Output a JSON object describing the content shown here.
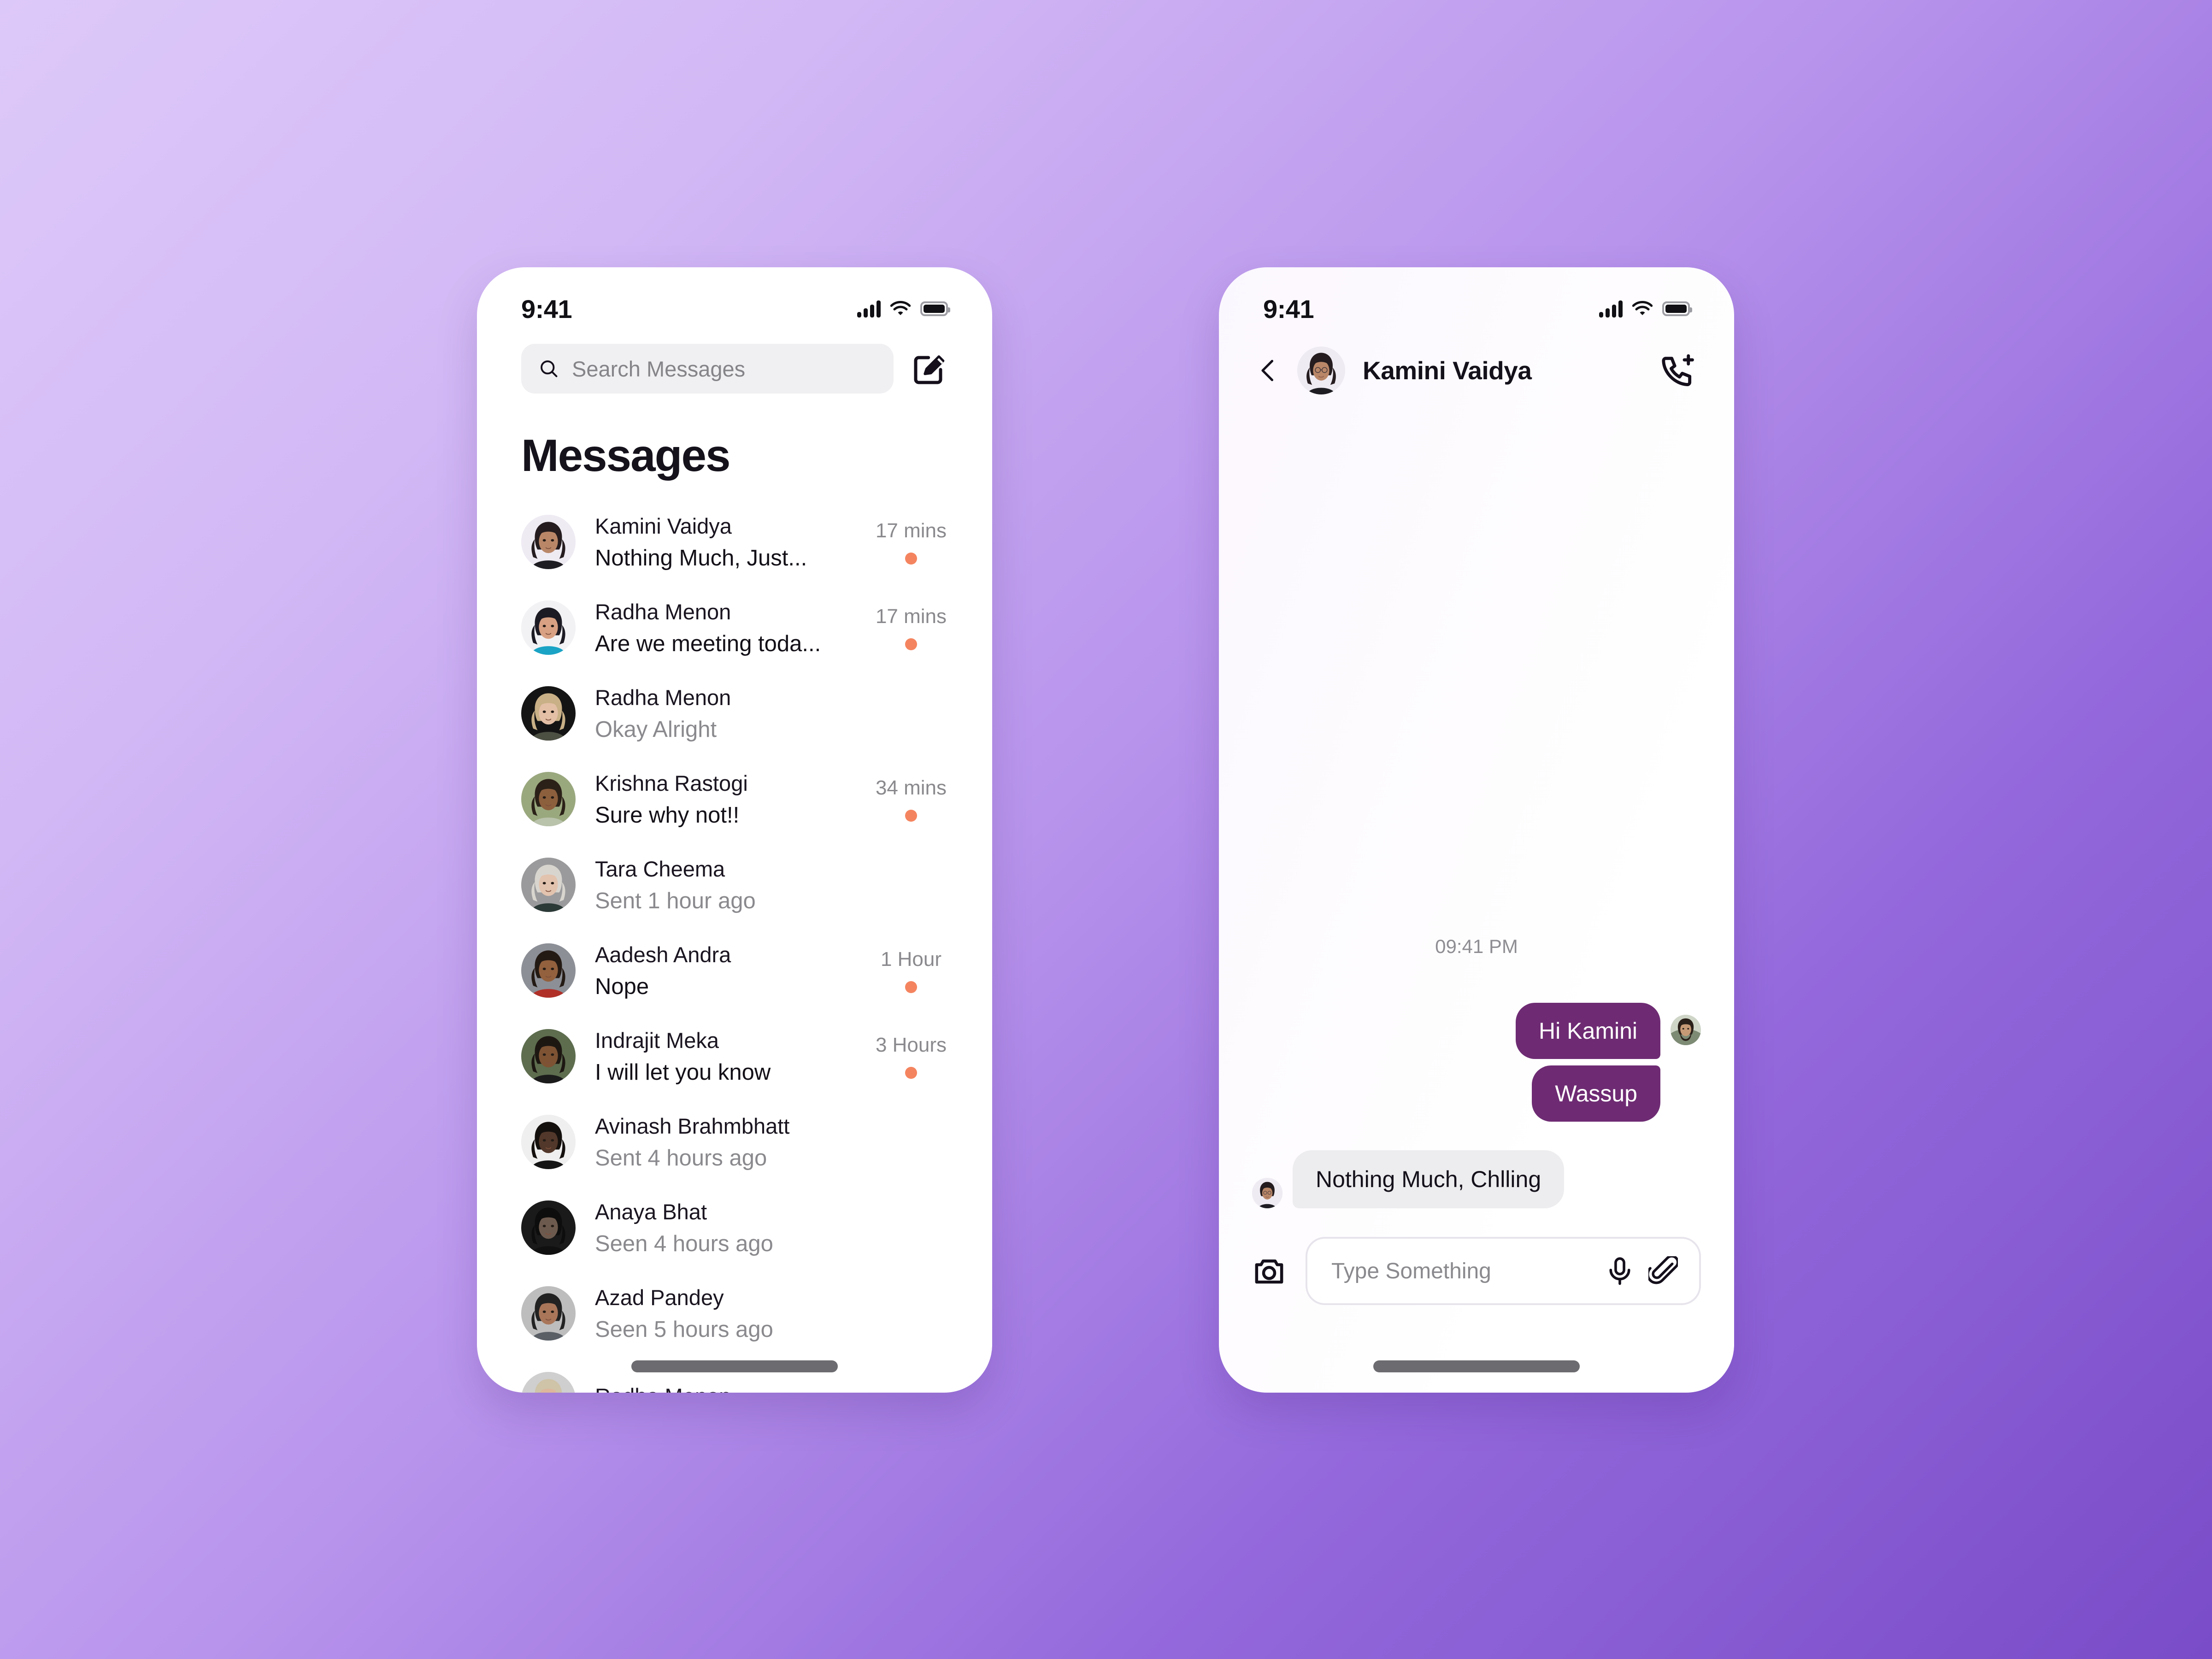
{
  "screen_list": {
    "status_bar": {
      "time": "9:41",
      "signal_icon": "cellular-signal-icon",
      "wifi_icon": "wifi-icon",
      "battery_icon": "battery-full-icon"
    },
    "search": {
      "placeholder": "Search Messages",
      "value": "",
      "icon": "search-icon"
    },
    "compose_icon": "compose-edit-icon",
    "title": "Messages",
    "conversations": [
      {
        "name": "Kamini Vaidya",
        "snippet": "Nothing Much, Just...",
        "time": "17 mins",
        "unread": true,
        "state": "unread"
      },
      {
        "name": "Radha Menon",
        "snippet": "Are we meeting toda...",
        "time": "17 mins",
        "unread": true,
        "state": "unread"
      },
      {
        "name": "Radha Menon",
        "snippet": "Okay Alright",
        "time": "",
        "unread": false,
        "state": "read"
      },
      {
        "name": "Krishna Rastogi",
        "snippet": "Sure why not!!",
        "time": "34 mins",
        "unread": true,
        "state": "unread"
      },
      {
        "name": "Tara Cheema",
        "snippet": "Sent 1 hour ago",
        "time": "",
        "unread": false,
        "state": "read"
      },
      {
        "name": "Aadesh Andra",
        "snippet": "Nope",
        "time": "1 Hour",
        "unread": true,
        "state": "unread"
      },
      {
        "name": "Indrajit Meka",
        "snippet": "I will let you know",
        "time": "3 Hours",
        "unread": true,
        "state": "unread"
      },
      {
        "name": "Avinash Brahmbhatt",
        "snippet": "Sent 4 hours ago",
        "time": "",
        "unread": false,
        "state": "read"
      },
      {
        "name": "Anaya Bhat",
        "snippet": "Seen 4 hours ago",
        "time": "",
        "unread": false,
        "state": "read"
      },
      {
        "name": "Azad Pandey",
        "snippet": "Seen 5 hours ago",
        "time": "",
        "unread": false,
        "state": "read"
      },
      {
        "name": "Radha Menon",
        "snippet": "",
        "time": "",
        "unread": false,
        "state": "read"
      }
    ]
  },
  "screen_chat": {
    "status_bar": {
      "time": "9:41",
      "signal_icon": "cellular-signal-icon",
      "wifi_icon": "wifi-icon",
      "battery_icon": "battery-full-icon"
    },
    "header": {
      "back_icon": "chevron-left-icon",
      "contact_name": "Kamini Vaidya",
      "action_icon": "add-call-icon"
    },
    "thread": {
      "timestamp": "09:41 PM",
      "messages": [
        {
          "text": "Hi Kamini",
          "side": "outgoing"
        },
        {
          "text": "Wassup",
          "side": "outgoing"
        },
        {
          "text": "Nothing Much, Chlling",
          "side": "incoming"
        }
      ]
    },
    "composer": {
      "camera_icon": "camera-icon",
      "placeholder": "Type Something",
      "value": "",
      "mic_icon": "microphone-icon",
      "attach_icon": "paperclip-icon"
    }
  },
  "theme": {
    "bubble_outgoing": "#6E2B73",
    "bubble_incoming": "#EDECEE",
    "unread_dot": "#F4845F",
    "search_field_bg": "#F0F0F2",
    "background_gradient_start": "#DDC9F9",
    "background_gradient_end": "#7A4CC8"
  }
}
